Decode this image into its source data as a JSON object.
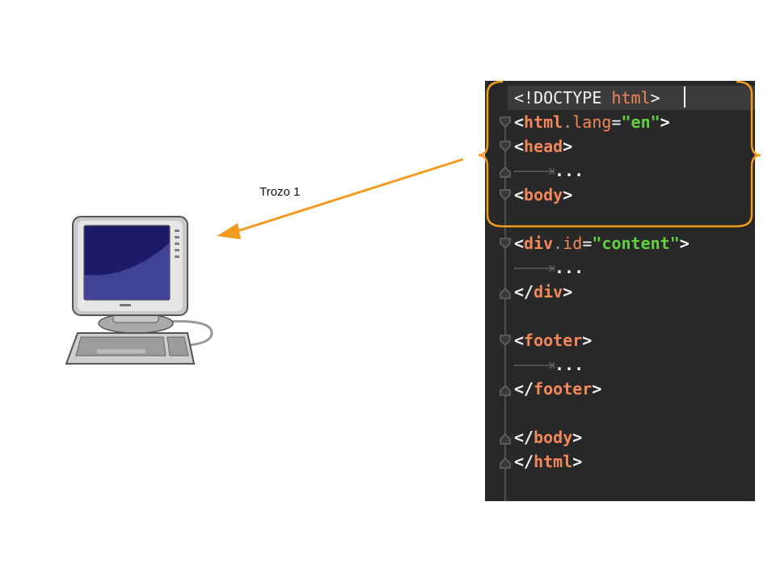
{
  "diagram": {
    "arrow_label": "Trozo 1",
    "accent_color": "#f39c1f",
    "computer_icon": "desktop-computer-icon"
  },
  "editor": {
    "background": "#282828",
    "line1": {
      "lt": "<!",
      "doctype": "DOCTYPE",
      "html": "html",
      "gt": ">"
    },
    "line2": {
      "lt": "<",
      "tag": "html",
      "attr": "lang",
      "eq": "=",
      "val": "\"en\"",
      "gt": ">"
    },
    "line3": {
      "lt": "<",
      "tag": "head",
      "gt": ">"
    },
    "line4": {
      "dots": "..."
    },
    "line5": {
      "lt": "<",
      "tag": "body",
      "gt": ">"
    },
    "line6": {
      "lt": "<",
      "tag": "div",
      "attr": "id",
      "eq": "=",
      "val": "\"content\"",
      "gt": ">"
    },
    "line7": {
      "dots": "..."
    },
    "line8": {
      "lt": "</",
      "tag": "div",
      "gt": ">"
    },
    "line9": {
      "lt": "<",
      "tag": "footer",
      "gt": ">"
    },
    "line10": {
      "dots": "..."
    },
    "line11": {
      "lt": "</",
      "tag": "footer",
      "gt": ">"
    },
    "line12": {
      "lt": "</",
      "tag": "body",
      "gt": ">"
    },
    "line13": {
      "lt": "</",
      "tag": "html",
      "gt": ">"
    }
  }
}
